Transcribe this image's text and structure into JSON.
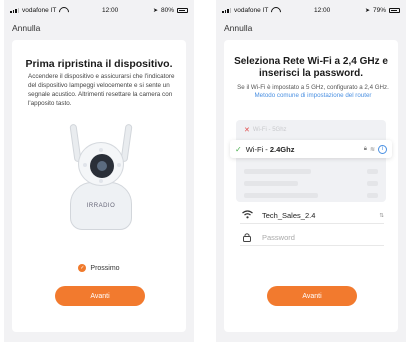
{
  "status_left": {
    "carrier": "vodafone IT",
    "time": "12:00",
    "battery": "80%"
  },
  "status_right": {
    "carrier": "vodafone IT",
    "time": "12:00",
    "battery": "79%"
  },
  "left": {
    "cancel": "Annulla",
    "title": "Prima ripristina il dispositivo.",
    "desc": "Accendere il dispositivo e assicurarsi che l'indicatore del dispositivo lampeggi velocemente e si sente un segnale acustico. Altrimenti resettare la camera con l'apposito tasto.",
    "brand": "IRRADIO",
    "next_label": "Prossimo",
    "button": "Avanti"
  },
  "right": {
    "cancel": "Annulla",
    "title": "Seleziona Rete Wi-Fi a 2,4 GHz e inserisci la password.",
    "info": "Se il Wi-Fi è impostato a 5 GHz, configurato a 2,4 GHz.",
    "info_link": "Metodo comune di impostazione del router",
    "wifi_5g": "Wi-Fi - 5Ghz",
    "wifi_24_prefix": "Wi-Fi - ",
    "wifi_24_bold": "2.4Ghz",
    "ssid": "Tech_Sales_2.4",
    "ssid_tail": "⇅",
    "password_placeholder": "Password",
    "button": "Avanti"
  },
  "colors": {
    "accent": "#f27a2e",
    "link": "#4a90e2",
    "check": "#4cb050"
  },
  "icons": [
    "wifi-icon",
    "lock-icon",
    "info-icon",
    "check-icon",
    "close-icon"
  ]
}
